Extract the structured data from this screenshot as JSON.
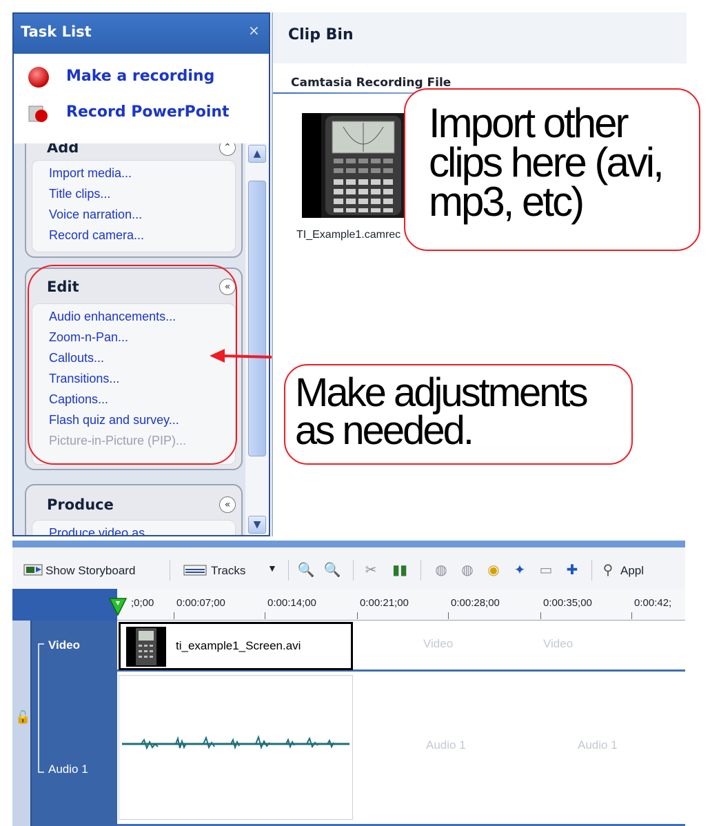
{
  "task_list": {
    "title": "Task List",
    "close_glyph": "×",
    "record_items": [
      {
        "label": "Make a recording",
        "icon": "record-circle-icon"
      },
      {
        "label": "Record PowerPoint",
        "icon": "powerpoint-record-icon"
      }
    ],
    "groups": [
      {
        "title": "Add",
        "collapse_glyph": "⌃",
        "items": [
          "Import media...",
          "Title clips...",
          "Voice narration...",
          "Record camera..."
        ]
      },
      {
        "title": "Edit",
        "collapse_glyph": "«",
        "items": [
          "Audio enhancements...",
          "Zoom-n-Pan...",
          "Callouts...",
          "Transitions...",
          "Captions...",
          "Flash quiz and survey...",
          "Picture-in-Picture (PIP)..."
        ],
        "disabled_item_index": 6
      },
      {
        "title": "Produce",
        "collapse_glyph": "«",
        "items": [
          "Produce video as..."
        ]
      }
    ]
  },
  "clip_bin": {
    "title": "Clip Bin",
    "section": "Camtasia Recording File",
    "clip_name": "TI_Example1.camrec"
  },
  "callouts": {
    "import": "Import other clips here (avi, mp3, etc)",
    "adjust": "Make adjustments as needed."
  },
  "toolbar": {
    "storyboard_label": "Show Storyboard",
    "tracks_label": "Tracks",
    "apply_label": "Appl"
  },
  "timeline": {
    "ruler_labels": [
      ";0;00",
      "0:00:07;00",
      "0:00:14;00",
      "0:00:21;00",
      "0:00:28;00",
      "0:00:35;00",
      "0:00:42;"
    ],
    "tracks": {
      "video": "Video",
      "audio": "Audio 1"
    },
    "video_clip_name": "ti_example1_Screen.avi",
    "ghost_video": "Video",
    "ghost_audio": "Audio 1"
  },
  "colors": {
    "accent": "#3f6fb5",
    "link": "#1a36c8",
    "callout_border": "#ee1c24"
  }
}
